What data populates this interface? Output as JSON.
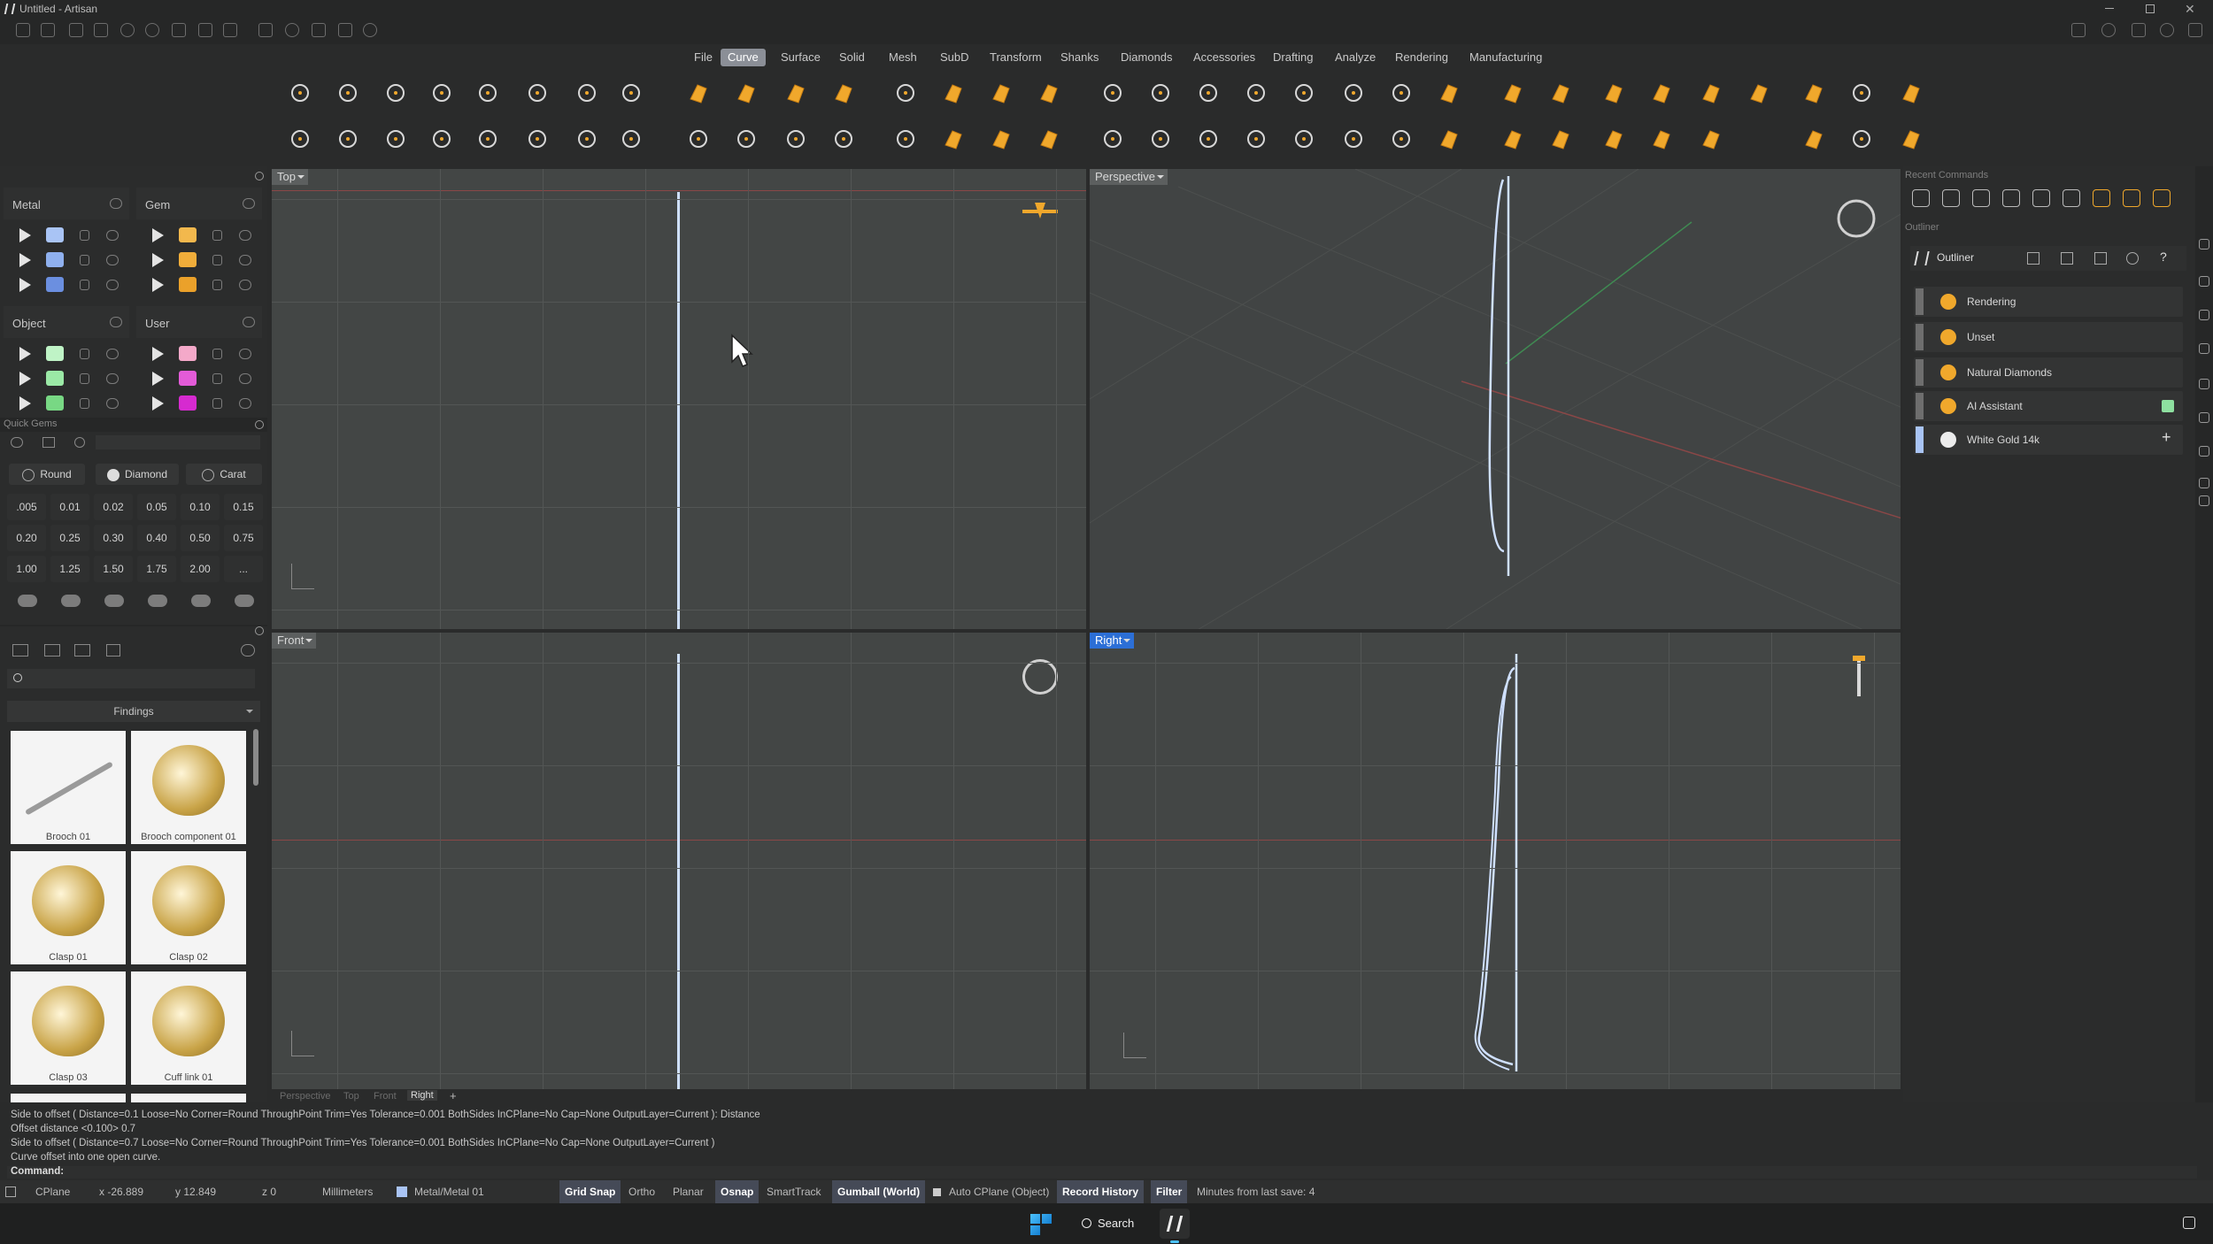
{
  "window": {
    "title": "Untitled - Artisan"
  },
  "menu_tabs": [
    "File",
    "Curve",
    "Surface",
    "Solid",
    "Mesh",
    "SubD",
    "Transform",
    "Shanks",
    "Diamonds",
    "Accessories",
    "Drafting",
    "Analyze",
    "Rendering",
    "Manufacturing"
  ],
  "active_tab": "Curve",
  "layers": {
    "groups": [
      {
        "name": "Metal",
        "swatches": [
          "#a9c4f5",
          "#8fb0ee",
          "#6b8fe0"
        ]
      },
      {
        "name": "Gem",
        "swatches": [
          "#f2b84d",
          "#f0ad3a",
          "#eba12a"
        ]
      },
      {
        "name": "Object",
        "swatches": [
          "#bff3c6",
          "#9be9a6",
          "#78d884"
        ]
      },
      {
        "name": "User",
        "swatches": [
          "#f4a9c9",
          "#e35bd8",
          "#d62ad0"
        ]
      }
    ]
  },
  "quick_gems": {
    "title": "Quick Gems",
    "shape_round": "Round",
    "shape_diamond": "Diamond",
    "shape_carat": "Carat",
    "sizes": [
      ".005",
      "0.01",
      "0.02",
      "0.05",
      "0.10",
      "0.15",
      "0.20",
      "0.25",
      "0.30",
      "0.40",
      "0.50",
      "0.75",
      "1.00",
      "1.25",
      "1.50",
      "1.75",
      "2.00",
      "..."
    ]
  },
  "library": {
    "category": "Findings",
    "items": [
      "Brooch 01",
      "Brooch component 01",
      "Clasp 01",
      "Clasp 02",
      "Clasp 03",
      "Cuff link 01"
    ]
  },
  "viewports": {
    "top": "Top",
    "perspective": "Perspective",
    "front": "Front",
    "right": "Right",
    "tabs": [
      "Perspective",
      "Top",
      "Front",
      "Right"
    ]
  },
  "right_panel": {
    "recent_commands": "Recent Commands",
    "outliner_header": "Outliner",
    "outliner_title": "Outliner",
    "rows": [
      "Rendering",
      "Unset",
      "Natural Diamonds",
      "AI Assistant",
      "White Gold 14k"
    ]
  },
  "command_history": [
    "Side to offset ( Distance=0.1  Loose=No  Corner=Round  ThroughPoint  Trim=Yes  Tolerance=0.001  BothSides  InCPlane=No  Cap=None  OutputLayer=Current ): Distance",
    "Offset distance <0.100> 0.7",
    "Side to offset ( Distance=0.7  Loose=No  Corner=Round  ThroughPoint  Trim=Yes  Tolerance=0.001  BothSides  InCPlane=No  Cap=None  OutputLayer=Current )",
    "Curve offset into one open curve."
  ],
  "command_prompt": "Command:",
  "status": {
    "cplane": "CPlane",
    "x": "x -26.889",
    "y": "y 12.849",
    "z": "z 0",
    "units": "Millimeters",
    "layer": "Metal/Metal 01",
    "grid_snap": "Grid Snap",
    "ortho": "Ortho",
    "planar": "Planar",
    "osnap": "Osnap",
    "smarttrack": "SmartTrack",
    "gumball": "Gumball (World)",
    "auto_cplane": "Auto CPlane (Object)",
    "record_history": "Record History",
    "filter": "Filter",
    "minutes": "Minutes from last save: 4"
  },
  "taskbar": {
    "search": "Search"
  },
  "colors": {
    "accent": "#2c6fd6",
    "gem_orange": "#f0a82c",
    "curve": "#cfe0ff",
    "viewport_bg": "#434645"
  }
}
